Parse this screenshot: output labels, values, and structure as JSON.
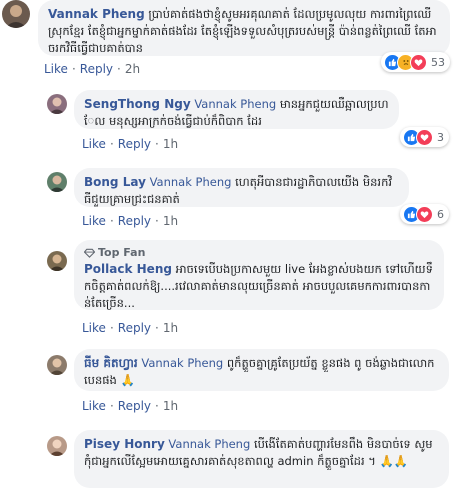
{
  "comments": [
    {
      "author": "Vannak Pheng",
      "tag": "",
      "text": "ប្រាប់គាត់ផងថាខ្ញុំសូមអរគុណគាត់ ដែលប្រមូលលុយ ការពារព្រៃឈើ ស្រុកខ្មែរ តែខ្ញុំជាអ្នកម្នាក់គាត់ផងដែរ តែខ្ញុំ​ឡើង​ទទួលសំ​បុត្រ​របស់​មន្ត្រី ប៉ាន់ពន្លត់ព្រៃឈើ តែអាច​រក​វិធី​ធ្វើ​ជាប​គាត់​បាន",
      "like": "Like",
      "reply": "Reply",
      "time": "2h",
      "reaction_count": "53"
    },
    {
      "author": "SengThong Ngy",
      "tag": "Vannak Pheng",
      "text": "មានអ្នកជួយឈឺឆ្អាលប្រហែល មនុស្សអាក្រក់ចង់ធ្វើជាប់ក៏ពិបាក ដែរ",
      "like": "Like",
      "reply": "Reply",
      "time": "1h",
      "reaction_count": "3"
    },
    {
      "author": "Bong Lay",
      "tag": "Vannak Pheng",
      "text": "ហេតុអីបានជារដ្ឋាភិបាលយើង មិនរកវិធីជួយគ្រាមជ្រះជនគាត់",
      "like": "Like",
      "reply": "Reply",
      "time": "1h",
      "reaction_count": "6"
    },
    {
      "badge": "Top Fan",
      "author": "Pollack Heng",
      "tag": "",
      "text": "អាចទេបើបងប្រកាសមួយ live អែងខ្លាស់បងយក ទៅហើយទឹកចិត្តគាត់ពលក់ឱ្យ....រវេលាគាត់មានលុយច្រើនគាត់ អាចបបួលគេមកការពារបានកាន់តែច្រើន...",
      "like": "Like",
      "reply": "Reply",
      "time": "1h"
    },
    {
      "author": "ធីម គិតហ្វារ",
      "tag": "Vannak Pheng",
      "text": "ពូក៏ត្ហួចគ្នាគ្រូតែប្រយ័ត្ន ខ្លួនផង ពូ ចង់ឆ្លាងជាលោកបេនផង",
      "emoji": "🙏",
      "like": "Like",
      "reply": "Reply",
      "time": "1h"
    },
    {
      "author": "Pisey Honry",
      "tag": "Vannak Pheng",
      "text": "បើងើតែគាត់បញ្ហារមែនពឹង មិនបាច់ទេ សូមកុំជាអ្នកលើស្អែមអោយគ្នេសារគាត់សុខតាពល្ហ admin ក៏ត្ហួចគ្នាដែរ ។",
      "emoji": "🙏🙏",
      "like": "Like",
      "reply": "Reply",
      "time": "1h"
    }
  ],
  "colors": {
    "link": "#385898",
    "bubble": "#f2f3f5",
    "meta": "#606770",
    "like_reaction": "#1877f2",
    "love_reaction": "#f33e58",
    "sad_reaction": "#f7b125"
  }
}
